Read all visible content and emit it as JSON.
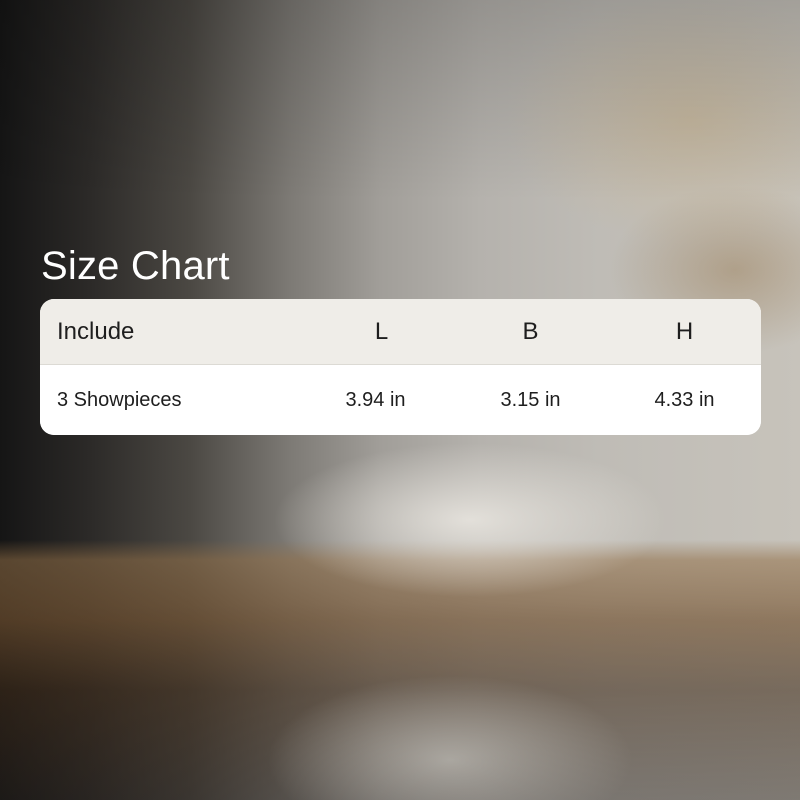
{
  "title": "Size Chart",
  "table": {
    "headers": [
      "Include",
      "L",
      "B",
      "H"
    ],
    "rows": [
      [
        "3 Showpieces",
        "3.94 in",
        "3.15 in",
        "4.33 in"
      ]
    ]
  },
  "colors": {
    "title_text": "#ffffff",
    "header_background": "#efede8",
    "row_background": "#ffffff",
    "cell_text": "#1e1e1e"
  }
}
